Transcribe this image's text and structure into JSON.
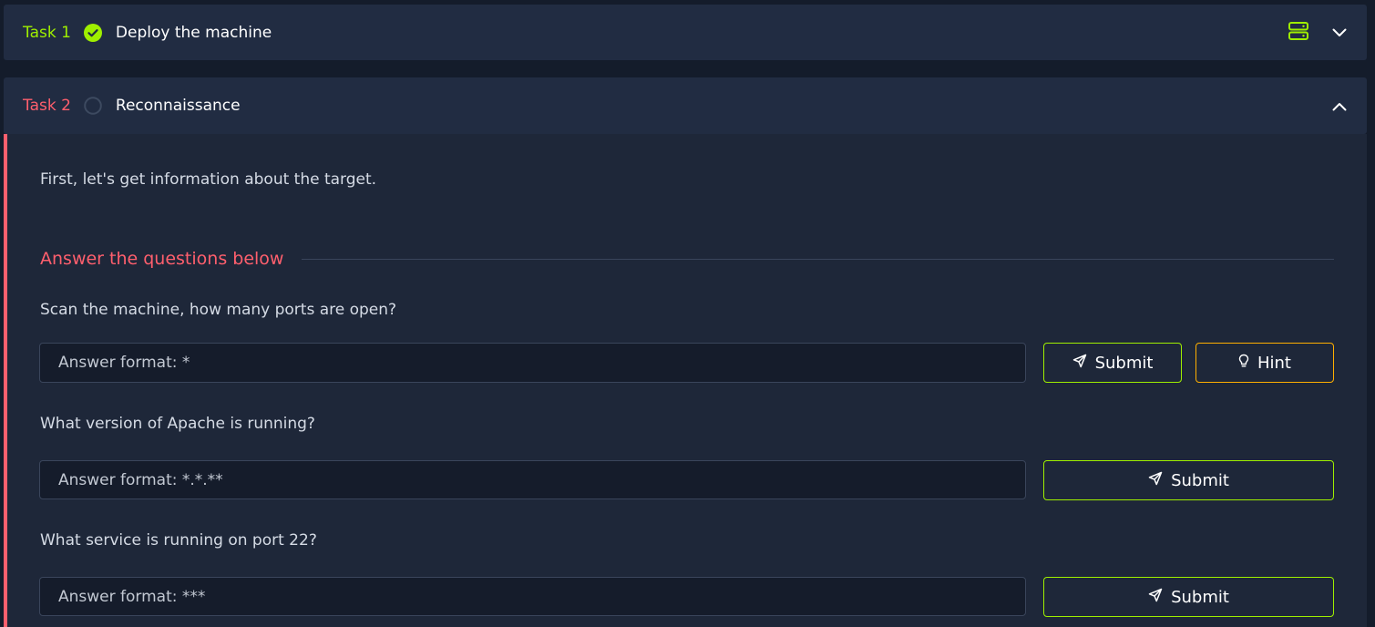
{
  "tasks": [
    {
      "label": "Task 1",
      "title": "Deploy the machine",
      "status": "complete",
      "status_icon": "check-circle-icon",
      "extra_icon": "server-icon",
      "toggle_icon": "chevron-down-icon"
    },
    {
      "label": "Task 2",
      "title": "Reconnaissance",
      "status": "incomplete",
      "status_icon": "empty-circle-icon",
      "toggle_icon": "chevron-up-icon",
      "intro": "First, let's get information about the target.",
      "questions_heading": "Answer the questions below",
      "questions": [
        {
          "text": "Scan the machine, how many ports are open?",
          "placeholder": "Answer format: *",
          "submit_label": "Submit",
          "hint_label": "Hint"
        },
        {
          "text": "What version of Apache is running?",
          "placeholder": "Answer format: *.*.**",
          "submit_label": "Submit"
        },
        {
          "text": "What service is running on port 22?",
          "placeholder": "Answer format: ***",
          "submit_label": "Submit"
        }
      ]
    }
  ],
  "colors": {
    "accent_green": "#9fef00",
    "accent_red": "#ff5f6d",
    "accent_orange": "#ffaf00",
    "header_bg": "#212c42",
    "body_bg": "#1e2739",
    "input_bg": "#151c2b"
  }
}
